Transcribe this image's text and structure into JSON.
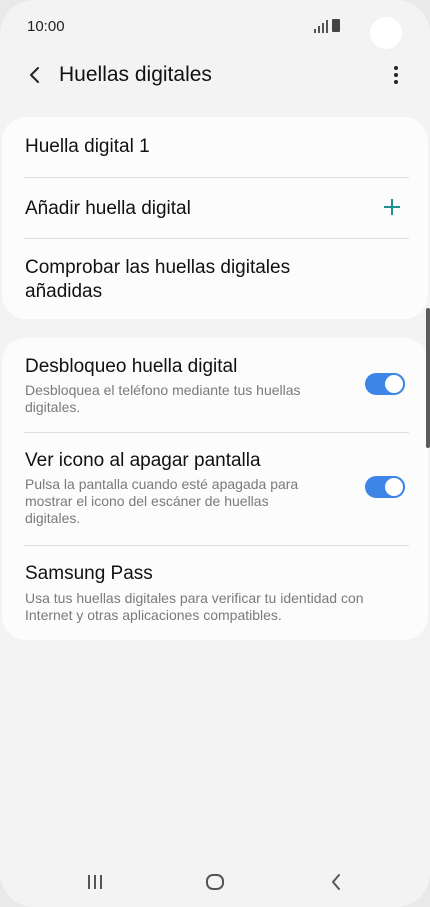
{
  "status_bar": {
    "time": "10:00"
  },
  "app_bar": {
    "title": "Huellas digitales"
  },
  "fingerprints": {
    "items": [
      {
        "label": "Huella digital 1"
      },
      {
        "label": "Añadir huella digital"
      },
      {
        "label": "Comprobar las huellas digitales añadidas"
      }
    ]
  },
  "settings": {
    "unlock": {
      "title": "Desbloqueo huella digital",
      "subtitle": "Desbloquea el teléfono mediante tus huellas digitales.",
      "enabled": true
    },
    "screen_off_icon": {
      "title": "Ver icono al apagar pantalla",
      "subtitle": "Pulsa la pantalla cuando esté apagada para mostrar el icono del escáner de huellas digitales.",
      "enabled": true
    },
    "samsung_pass": {
      "title": "Samsung Pass",
      "subtitle": "Usa tus huellas digitales para verificar tu identidad con Internet y otras aplicaciones compatibles."
    }
  },
  "colors": {
    "accent": "#3e85e8",
    "add_icon": "#1c8f8c",
    "background": "#f3f3f3",
    "card": "#fcfcfc"
  },
  "icons": [
    "back-arrow-icon",
    "more-options-icon",
    "plus-icon",
    "recent-apps-icon",
    "home-icon",
    "nav-back-icon"
  ]
}
